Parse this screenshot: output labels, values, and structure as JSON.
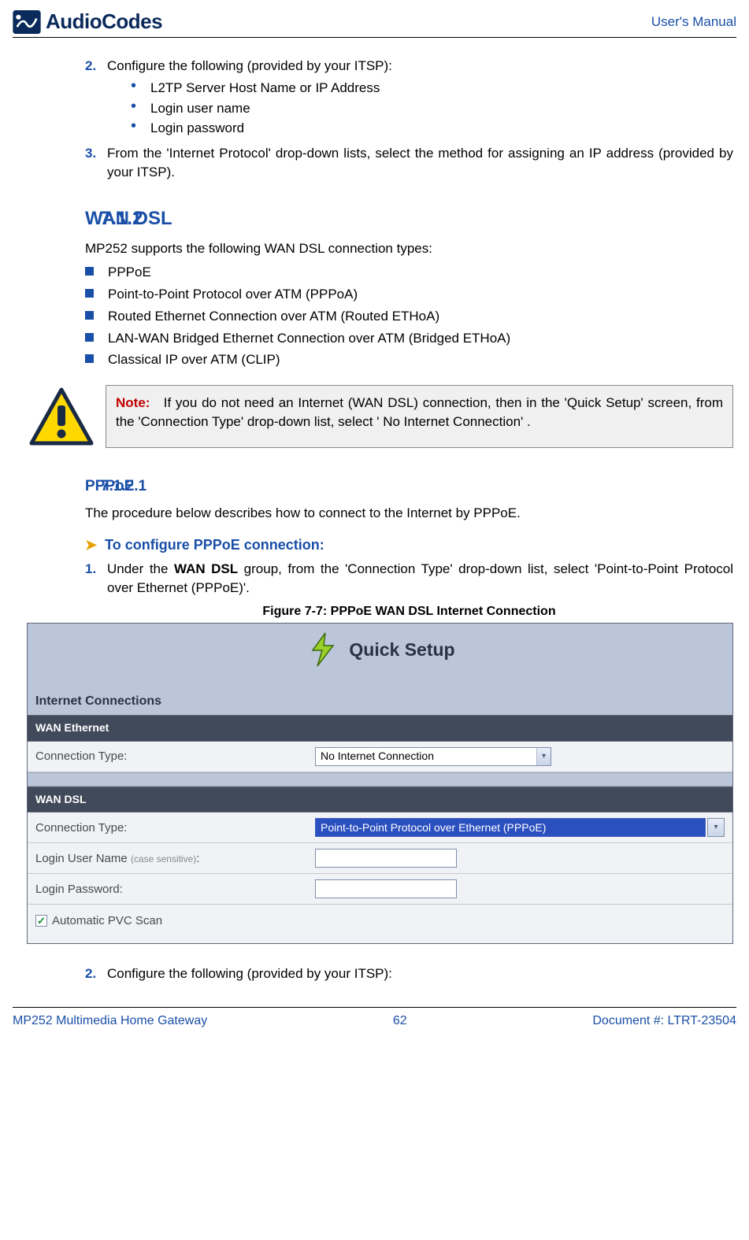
{
  "header": {
    "logo_text": "AudioCodes",
    "right_text": "User's Manual"
  },
  "top_steps": {
    "s2_num": "2.",
    "s2_text": "Configure the following (provided by your ITSP):",
    "s2_bullets": [
      "L2TP Server Host Name or IP Address",
      "Login user name",
      "Login password"
    ],
    "s3_num": "3.",
    "s3_text": "From the 'Internet Protocol' drop-down lists, select the method for assigning an IP address (provided by your ITSP)."
  },
  "wan_dsl": {
    "num": "7.1.2",
    "title": "WAN DSL",
    "intro": "MP252 supports the following WAN DSL connection types:",
    "items": [
      "PPPoE",
      "Point-to-Point Protocol over ATM (PPPoA)",
      "Routed Ethernet Connection over ATM (Routed ETHoA)",
      "LAN-WAN Bridged Ethernet Connection over ATM (Bridged ETHoA)",
      "Classical IP over ATM (CLIP)"
    ]
  },
  "note": {
    "label": "Note:",
    "text": "If you do not need an Internet (WAN DSL) connection, then in the 'Quick Setup' screen, from the 'Connection Type' drop-down list, select ' No Internet Connection' ."
  },
  "pppoe": {
    "num": "7.1.2.1",
    "title": "PPPoE",
    "intro": "The procedure below describes how to connect to the Internet by PPPoE.",
    "config_heading": "To configure PPPoE connection:",
    "s1_num": "1.",
    "s1_text_pre": "Under the ",
    "s1_text_bold": "WAN DSL",
    "s1_text_post": " group, from the 'Connection Type' drop-down list, select 'Point-to-Point Protocol over Ethernet (PPPoE)'.",
    "fig_caption": "Figure 7-7: PPPoE WAN DSL Internet Connection",
    "after_num": "2.",
    "after_text": "Configure the following (provided by your ITSP):"
  },
  "figure": {
    "quick_label": "Quick Setup",
    "section_label": "Internet Connections",
    "wan_eth_bar": "WAN Ethernet",
    "conn_type_label": "Connection Type:",
    "eth_dropdown_value": "No Internet Connection",
    "wan_dsl_bar": "WAN DSL",
    "dsl_dropdown_value": "Point-to-Point Protocol over Ethernet (PPPoE)",
    "login_user_label": "Login User Name ",
    "login_user_sub": "(case sensitive)",
    "login_user_colon": ":",
    "login_pass_label": "Login Password:",
    "auto_pvc_label": "Automatic PVC Scan"
  },
  "footer": {
    "left": "MP252 Multimedia Home Gateway",
    "center": "62",
    "right": "Document #: LTRT-23504"
  }
}
